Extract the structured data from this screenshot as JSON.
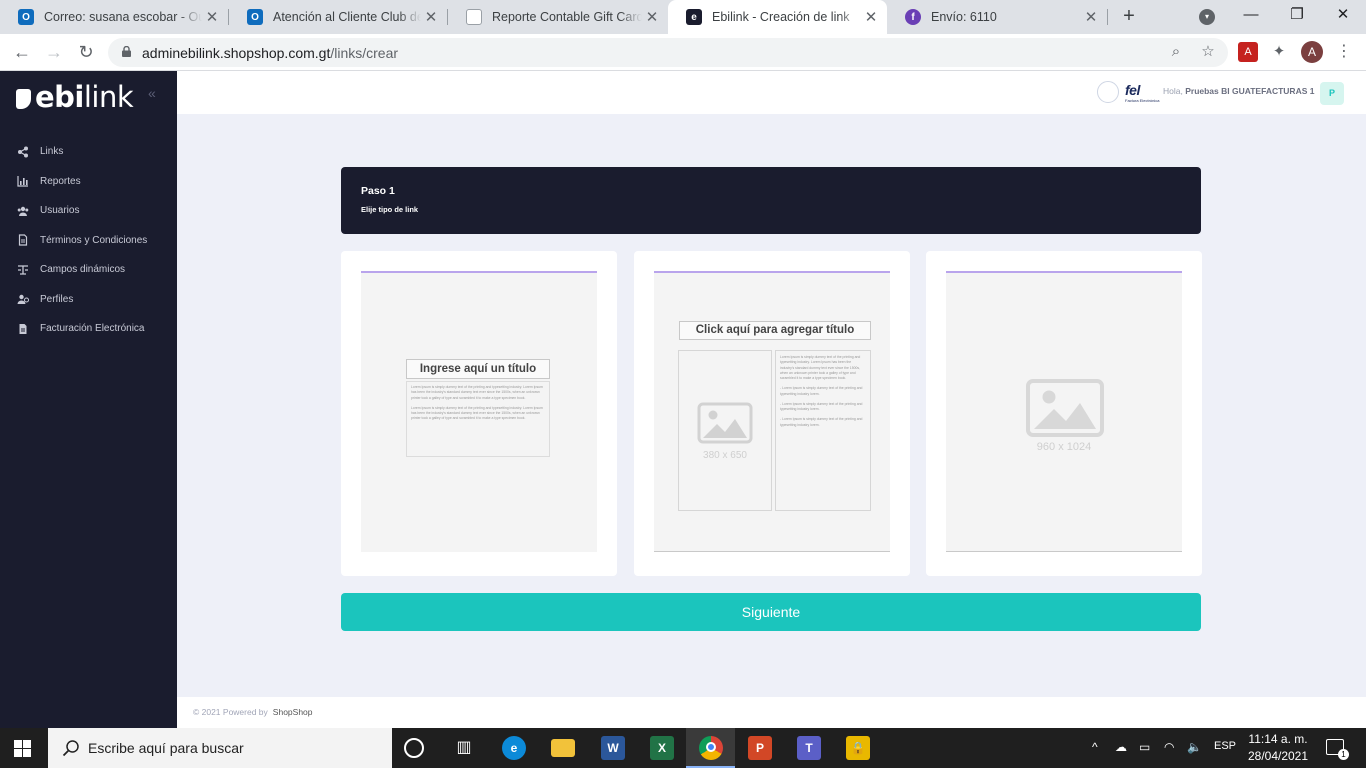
{
  "browser": {
    "tabs": [
      {
        "title": "Correo: susana escobar - Outlook",
        "favicon": "outlook-icon",
        "color": "#0f6cbd",
        "active": false
      },
      {
        "title": "Atención al Cliente Club de Compras",
        "favicon": "outlook-icon",
        "color": "#0f6cbd",
        "active": false
      },
      {
        "title": "Reporte Contable Gift Cards - Google Docs",
        "favicon": "document-icon",
        "color": "#9aa0a6",
        "active": false
      },
      {
        "title": "Ebilink - Creación de link",
        "favicon": "ebilink-icon",
        "color": "#1a1c2e",
        "active": true
      },
      {
        "title": "Envío: 6110",
        "favicon": "facturas-icon",
        "color": "#6a3fb5",
        "active": false
      }
    ],
    "new_tab": "+",
    "url_host": "adminebilink.shopshop.com.gt",
    "url_path": "/links/crear",
    "profile_initial": "A"
  },
  "app": {
    "brand_bold": "ebi",
    "brand_light": "link",
    "collapse_symbol": "«",
    "sidebar": [
      {
        "label": "Links",
        "icon": "share-icon"
      },
      {
        "label": "Reportes",
        "icon": "bar-chart-icon"
      },
      {
        "label": "Usuarios",
        "icon": "users-icon"
      },
      {
        "label": "Términos y Condiciones",
        "icon": "document-icon"
      },
      {
        "label": "Campos dinámicos",
        "icon": "fields-icon"
      },
      {
        "label": "Perfiles",
        "icon": "profiles-icon"
      },
      {
        "label": "Facturación Electrónica",
        "icon": "invoice-icon"
      }
    ],
    "header": {
      "fel_logo": "fel",
      "fel_sub": "Factura Electrónica",
      "greeting": "Hola,",
      "user_name": "Pruebas BI GUATEFACTURAS 1",
      "user_initial": "P"
    },
    "step": {
      "title": "Paso 1",
      "subtitle": "Elije tipo de link"
    },
    "templates": {
      "t1": {
        "title": "Ingrese aquí un título",
        "para1": "Lorem Ipsum is simply dummy text of the printing and typesetting industry. Lorem Ipsum has been the industry's standard dummy text ever since the 1500s, when an unknown printer took a galley of type and scrambled it to make a type specimen book.",
        "para2": "Lorem Ipsum is simply dummy text of the printing and typesetting industry. Lorem Ipsum has been the industry's standard dummy text ever since the 1500s, when an unknown printer took a galley of type and scrambled it to make a type specimen book."
      },
      "t2": {
        "title": "Click aquí para agregar título",
        "img_label": "380 x 650",
        "para1": "Lorem Ipsum is simply dummy text of the printing and typesetting industry. Lorem Ipsum has been the industry's standard dummy text ever since the 1500s, when an unknown printer took a galley of type and scrambled it to make a type specimen book.",
        "bullet1": "- Lorem Ipsum is simply dummy text of the printing and typesetting industry lorem.",
        "bullet2": "- Lorem Ipsum is simply dummy text of the printing and typesetting industry lorem.",
        "bullet3": "- Lorem Ipsum is simply dummy text of the printing and typesetting industry lorem."
      },
      "t3": {
        "img_label": "960 x 1024"
      }
    },
    "next_button": "Siguiente",
    "footer": {
      "copyright": "© 2021 Powered by",
      "brand": "ShopShop"
    }
  },
  "taskbar": {
    "search_placeholder": "Escribe aquí para buscar",
    "apps": [
      "cortana-icon",
      "task-view-icon",
      "edge-icon",
      "file-explorer-icon",
      "word-icon",
      "excel-icon",
      "chrome-icon",
      "powerpoint-icon",
      "teams-icon",
      "lock-app-icon"
    ],
    "language": "ESP",
    "time": "11:14 a. m.",
    "date": "28/04/2021",
    "notification_count": "1"
  }
}
